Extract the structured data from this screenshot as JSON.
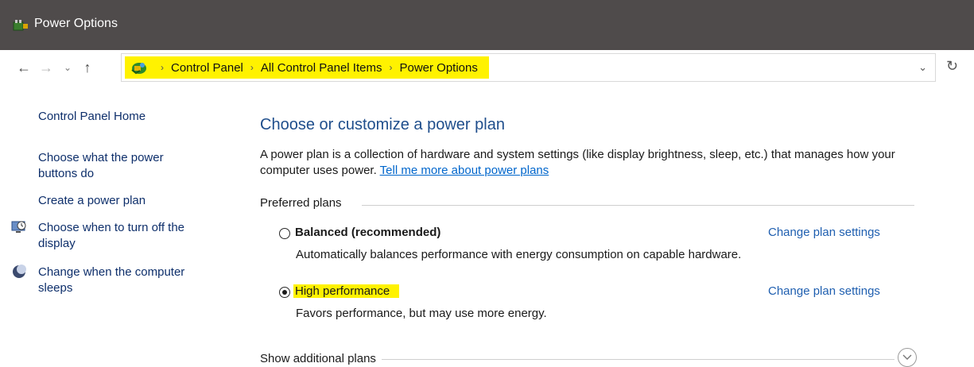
{
  "window": {
    "title": "Power Options"
  },
  "nav": {
    "back_icon": "←",
    "forward_icon": "→",
    "recent_icon": "⌄",
    "up_icon": "↑",
    "refresh_icon": "↻",
    "dropdown_icon": "⌄"
  },
  "breadcrumb": {
    "items": [
      "Control Panel",
      "All Control Panel Items",
      "Power Options"
    ],
    "separator": "›"
  },
  "sidebar": {
    "home": "Control Panel Home",
    "links": [
      {
        "label": "Choose what the power buttons do",
        "icon": null
      },
      {
        "label": "Create a power plan",
        "icon": null
      },
      {
        "label": "Choose when to turn off the display",
        "icon": "display-clock-icon"
      },
      {
        "label": "Change when the computer sleeps",
        "icon": "moon-icon"
      }
    ]
  },
  "main": {
    "title": "Choose or customize a power plan",
    "description": "A power plan is a collection of hardware and system settings (like display brightness, sleep, etc.) that manages how your computer uses power.",
    "learn_more": "Tell me more about power plans",
    "preferred_header": "Preferred plans",
    "plans": [
      {
        "name": "Balanced (recommended)",
        "description": "Automatically balances performance with energy consumption on capable hardware.",
        "selected": false,
        "change_label": "Change plan settings"
      },
      {
        "name": "High performance",
        "description": "Favors performance, but may use more energy.",
        "selected": true,
        "change_label": "Change plan settings"
      }
    ],
    "additional_header": "Show additional plans",
    "expand_icon": "chevron-down-icon"
  },
  "colors": {
    "titlebar": "#4f4b4b",
    "highlight": "#fff200",
    "link": "#1f5fb0",
    "heading": "#1f4e8c"
  }
}
